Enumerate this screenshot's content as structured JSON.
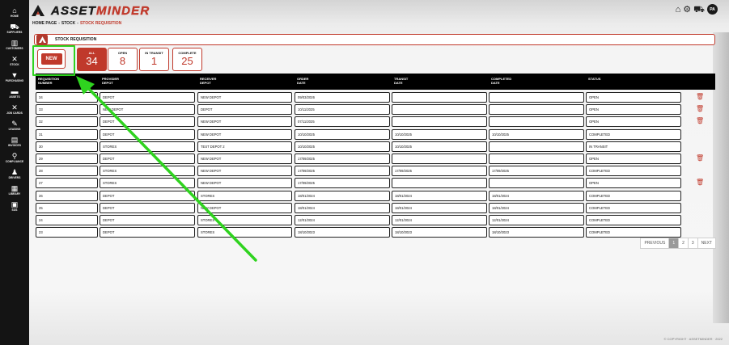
{
  "app": {
    "logo_part1": "ASSET",
    "logo_part2": "MINDER",
    "copyright": "© COPYRIGHT · ASSETMINDER · 2022",
    "avatar_initials": "PA"
  },
  "sidebar": {
    "items": [
      {
        "label": "HOME",
        "icon": "⌂"
      },
      {
        "label": "SUPPLIERS",
        "icon": "⛟"
      },
      {
        "label": "CUSTOMERS",
        "icon": "▥"
      },
      {
        "label": "STOCK",
        "icon": "✕"
      },
      {
        "label": "PURCHASING",
        "icon": "▼"
      },
      {
        "label": "ASSETS",
        "icon": "▬"
      },
      {
        "label": "JOB CARDS",
        "icon": "✕"
      },
      {
        "label": "LEASING",
        "icon": "✎"
      },
      {
        "label": "INVOICES",
        "icon": "▤"
      },
      {
        "label": "COMPLIANCE",
        "icon": "⚲"
      },
      {
        "label": "DRIVERS",
        "icon": "♟"
      },
      {
        "label": "LIBRARY",
        "icon": "▦"
      },
      {
        "label": "SOS",
        "icon": "▣"
      }
    ]
  },
  "breadcrumb": {
    "home": "HOME PAGE",
    "stock": "STOCK",
    "current": "STOCK REQUISITION"
  },
  "page": {
    "title": "STOCK REQUISITION",
    "new_label": "NEW"
  },
  "tabs": [
    {
      "label": "ALL",
      "count": "34"
    },
    {
      "label": "OPEN",
      "count": "8"
    },
    {
      "label": "IN TRANSIT",
      "count": "1"
    },
    {
      "label": "COMPLETE",
      "count": "25"
    }
  ],
  "table": {
    "headers": [
      "REQUISITION\nNUMBER",
      "PROVIDER\nDEPOT",
      "RECEIVER\nDEPOT",
      "ORDER\nDATE",
      "TRANSIT\nDATE",
      "COMPLETED\nDATE",
      "STATUS"
    ],
    "rows": [
      {
        "cells": [
          "34",
          "DEPOT",
          "NEW DEPOT",
          "09/03/2026",
          "",
          "",
          "OPEN"
        ],
        "deletable": true
      },
      {
        "cells": [
          "33",
          "NEW DEPOT",
          "DEPOT",
          "10/11/2025",
          "",
          "",
          "OPEN"
        ],
        "deletable": true
      },
      {
        "cells": [
          "32",
          "DEPOT",
          "NEW DEPOT",
          "07/11/2025",
          "",
          "",
          "OPEN"
        ],
        "deletable": true
      },
      {
        "cells": [
          "31",
          "DEPOT",
          "NEW DEPOT",
          "10/10/2025",
          "10/10/2025",
          "10/10/2025",
          "COMPLETED"
        ],
        "deletable": false
      },
      {
        "cells": [
          "30",
          "STORES",
          "TEST DEPOT 2",
          "10/10/2025",
          "10/10/2025",
          "",
          "IN TRANSIT"
        ],
        "deletable": false
      },
      {
        "cells": [
          "29",
          "DEPOT",
          "NEW DEPOT",
          "17/09/2025",
          "",
          "",
          "OPEN"
        ],
        "deletable": true
      },
      {
        "cells": [
          "28",
          "STORES",
          "NEW DEPOT",
          "17/09/2025",
          "17/09/2025",
          "17/09/2025",
          "COMPLETED"
        ],
        "deletable": false
      },
      {
        "cells": [
          "27",
          "STORES",
          "NEW DEPOT",
          "17/09/2025",
          "",
          "",
          "OPEN"
        ],
        "deletable": true
      },
      {
        "cells": [
          "26",
          "DEPOT",
          "STORES",
          "18/01/2024",
          "18/01/2024",
          "18/01/2024",
          "COMPLETED"
        ],
        "deletable": false
      },
      {
        "cells": [
          "25",
          "DEPOT",
          "NEW DEPOT",
          "18/01/2024",
          "18/01/2024",
          "18/01/2024",
          "COMPLETED"
        ],
        "deletable": false
      },
      {
        "cells": [
          "24",
          "DEPOT",
          "STORES",
          "12/01/2024",
          "12/01/2024",
          "12/01/2024",
          "COMPLETED"
        ],
        "deletable": false
      },
      {
        "cells": [
          "23",
          "DEPOT",
          "STORES",
          "18/10/2023",
          "18/10/2023",
          "18/10/2023",
          "COMPLETED"
        ],
        "deletable": false
      }
    ]
  },
  "pagination": {
    "previous": "PREVIOUS",
    "pages": [
      "1",
      "2",
      "3"
    ],
    "current_page": "1",
    "next": "NEXT"
  },
  "colors": {
    "accent": "#c0392b",
    "highlight": "#2fd31f",
    "sidebar": "#141414"
  }
}
